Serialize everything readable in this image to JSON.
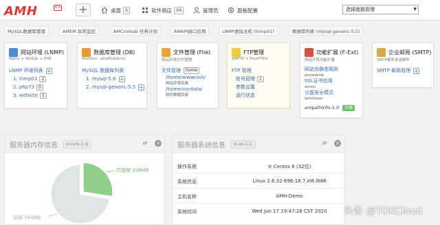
{
  "brand": {
    "logo": "AMH",
    "version": "6.6"
  },
  "nav": {
    "desktop": {
      "label": "桌面",
      "count": "6"
    },
    "store": {
      "label": "软件商店",
      "count": "99"
    },
    "admin": {
      "label": "管理员"
    },
    "panel_config": {
      "label": "面板配置"
    },
    "select": {
      "value": "选择面板管理"
    }
  },
  "shortcuts": [
    "MySQL数据库管理",
    "AMEM 异常监控",
    "AMCrontab 任务计划",
    "AMAPI接口应用",
    "LNMP虚拟主机 (lnmp01)",
    "数据库列表 (mysql-generic-5.5)"
  ],
  "cards": {
    "web": {
      "title": "网站环境 (LNMP)",
      "sub": "Nginx + MySQL + PHP",
      "list_title": "LNMP 环境列表",
      "items": [
        {
          "label": "1. lnmp01",
          "num": "2"
        },
        {
          "label": "2. php73",
          "num": "0"
        },
        {
          "label": "3. website",
          "num": "1"
        }
      ]
    },
    "db": {
      "title": "数据库管理 (DB)",
      "sub": "Madmin - phpMyAdmin",
      "list_title": "MySQL 数据库列表",
      "items": [
        {
          "label": "1. mysql-5.6"
        },
        {
          "label": "2. mysql-generic-5.5"
        }
      ]
    },
    "file": {
      "title": "文件管理 (File)",
      "sub": "网站环境文件管理",
      "link": "文件管理",
      "home": "home",
      "paths": [
        {
          "path": "/home/wwwroot/",
          "desc": "网站环境目录"
        },
        {
          "path": "/home/usrdata/",
          "desc": "软件数据目录"
        }
      ]
    },
    "ftp": {
      "title": "FTP管理",
      "sub": "AMFTP + PureFTPd",
      "link": "FTP 管理",
      "items": [
        {
          "label": "账号管理",
          "num": "1"
        },
        {
          "label": "参数设置"
        },
        {
          "label": "运行状态"
        }
      ]
    },
    "ext": {
      "title": "功能扩展 (F-Ext)",
      "sub": "网站环境功能扩展",
      "items": [
        {
          "label": "网站伪静态规则",
          "sub": "amrewrite"
        },
        {
          "label": "SSL证书应用",
          "sub": "amssl"
        },
        {
          "label": "沙盒安全模式",
          "sub": "amchroot"
        }
      ],
      "last": "ampathinfo-1.0",
      "upgrade": "升级"
    },
    "mail": {
      "title": "企业邮局 (SMTP)",
      "sub": "SMTP服务发送邮件",
      "link": "SMTP 邮局管理"
    }
  },
  "memory": {
    "title": "服务器内存信息",
    "tag": "d-ram-1.6",
    "used_label": "已使用 206MB",
    "free_label": "空闲 544MB",
    "used_mb": 206,
    "free_mb": 544
  },
  "system": {
    "title": "服务器系统信息",
    "tag": "d-os-1.1",
    "rows": [
      {
        "key": "操作系统",
        "value": "Centos 6 (32位)"
      },
      {
        "key": "系统信息",
        "value": "Linux 2.6.32-696.18.7.el6.i686"
      },
      {
        "key": "主机名称",
        "value": "AMH-Demo"
      },
      {
        "key": "系统时间",
        "value": "Wed Jun 17 19:47:28 CST 2020"
      }
    ]
  },
  "watermark": "头条 @TOKCloud"
}
